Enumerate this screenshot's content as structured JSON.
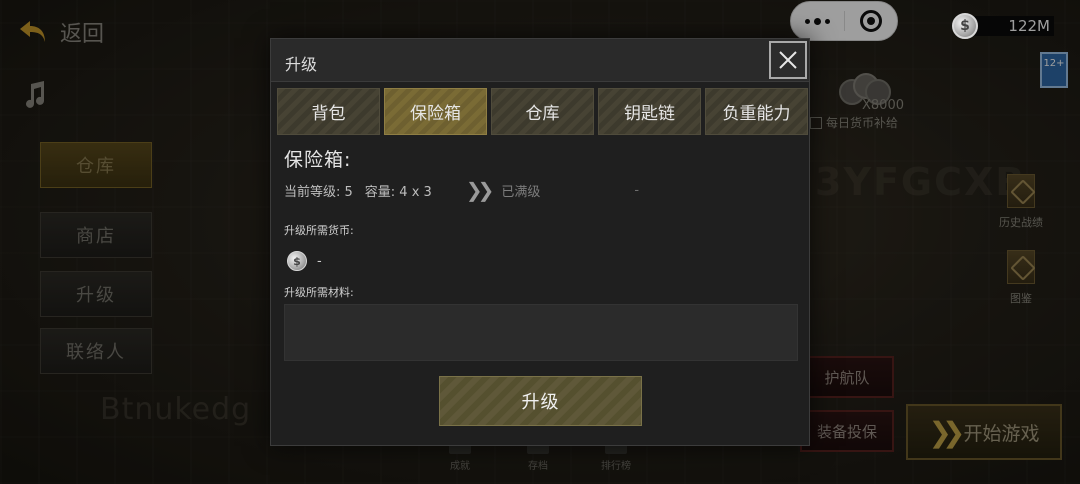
{
  "background": {
    "back_label": "返回",
    "side_tabs": [
      "仓库",
      "商店",
      "升级",
      "联络人"
    ],
    "ghost_text": "Btnukedg",
    "ghost_text2": "3YFGCXB",
    "currency_amount": "122M",
    "age_rating": "12+",
    "coin_bonus": "X8000",
    "daily_bonus": "每日货币补给",
    "right_icons": [
      "历史战绩",
      "图鉴"
    ],
    "escort_label": "护航队",
    "airdrop_label": "装备投保",
    "start_label": "开始游戏",
    "bottom_items": [
      "成就",
      "存档",
      "排行榜"
    ]
  },
  "modal": {
    "title": "升级",
    "tabs": [
      "背包",
      "保险箱",
      "仓库",
      "钥匙链",
      "负重能力"
    ],
    "active_tab": "保险箱",
    "section_title": "保险箱:",
    "current_level": "当前等级: 5",
    "capacity": "容量: 4 x 3",
    "maxed_label": "已满级",
    "next_placeholder": "-",
    "required_currency_label": "升级所需货币:",
    "required_currency_value": "-",
    "required_materials_label": "升级所需材料:",
    "upgrade_button": "升级"
  },
  "colors": {
    "accent_gold": "#7a6b35",
    "tab_olive": "#474334",
    "modal_bg": "#1f1f1f"
  }
}
